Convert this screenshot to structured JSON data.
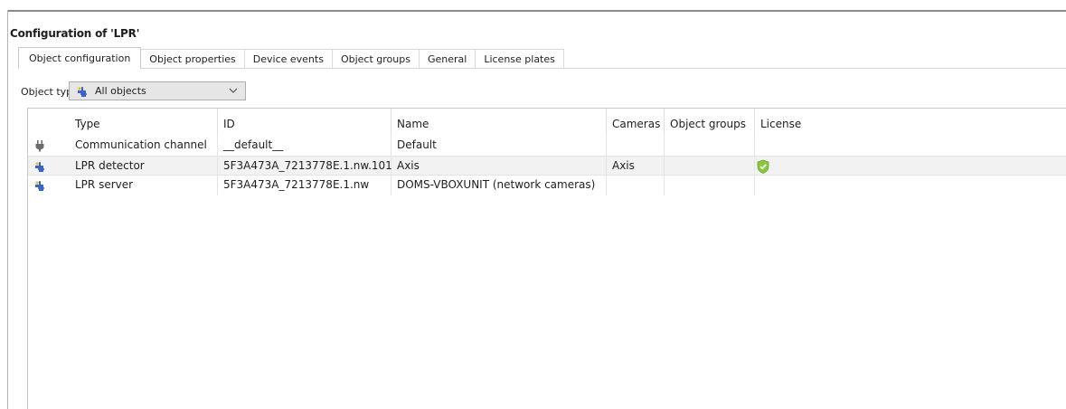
{
  "window": {
    "title": "Configuration of 'LPR'"
  },
  "tabs": [
    {
      "label": "Object configuration",
      "active": true
    },
    {
      "label": "Object properties"
    },
    {
      "label": "Device events"
    },
    {
      "label": "Object groups"
    },
    {
      "label": "General"
    },
    {
      "label": "License plates"
    }
  ],
  "filter": {
    "label": "Object type",
    "value": "All objects",
    "icon": "puzzle-piece-icon"
  },
  "table": {
    "columns": [
      "Type",
      "ID",
      "Name",
      "Cameras",
      "Object groups",
      "License"
    ],
    "rows": [
      {
        "icon": "plug-icon",
        "type": "Communication channel",
        "id": "__default__",
        "name": "Default",
        "cameras": "",
        "object_groups": "",
        "license": ""
      },
      {
        "icon": "puzzle-piece-icon",
        "type": "LPR detector",
        "id": "5F3A473A_7213778E.1.nw.101",
        "name": "Axis",
        "cameras": "Axis",
        "object_groups": "",
        "license": "shield-check-icon"
      },
      {
        "icon": "puzzle-piece-icon",
        "type": "LPR server",
        "id": "5F3A473A_7213778E.1.nw",
        "name": "DOMS-VBOXUNIT (network cameras)",
        "cameras": "",
        "object_groups": "",
        "license": ""
      }
    ]
  },
  "colors": {
    "selected_row": "#f2f2f2",
    "license_shield": "#8cc63f",
    "puzzle_icon": "#3a63c8"
  }
}
